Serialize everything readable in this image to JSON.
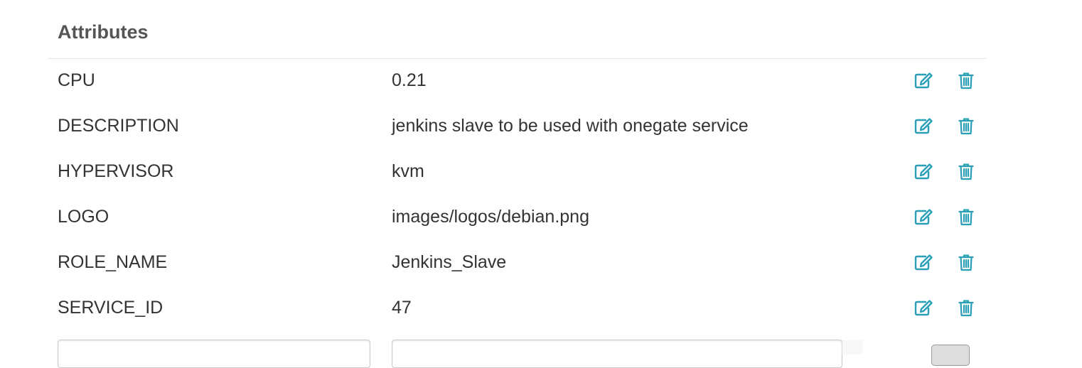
{
  "panel": {
    "title": "Attributes"
  },
  "attributes": [
    {
      "key": "CPU",
      "value": "0.21"
    },
    {
      "key": "DESCRIPTION",
      "value": "jenkins slave to be used with onegate service"
    },
    {
      "key": "HYPERVISOR",
      "value": "kvm"
    },
    {
      "key": "LOGO",
      "value": "images/logos/debian.png"
    },
    {
      "key": "ROLE_NAME",
      "value": "Jenkins_Slave"
    },
    {
      "key": "SERVICE_ID",
      "value": "47"
    }
  ],
  "icons": {
    "edit": "edit-icon",
    "delete": "trash-icon"
  },
  "colors": {
    "accent": "#2a9fb7",
    "text": "#333333",
    "title": "#555555",
    "rule": "#e6e6e6"
  },
  "new_attribute": {
    "key_value": "",
    "value_value": ""
  }
}
